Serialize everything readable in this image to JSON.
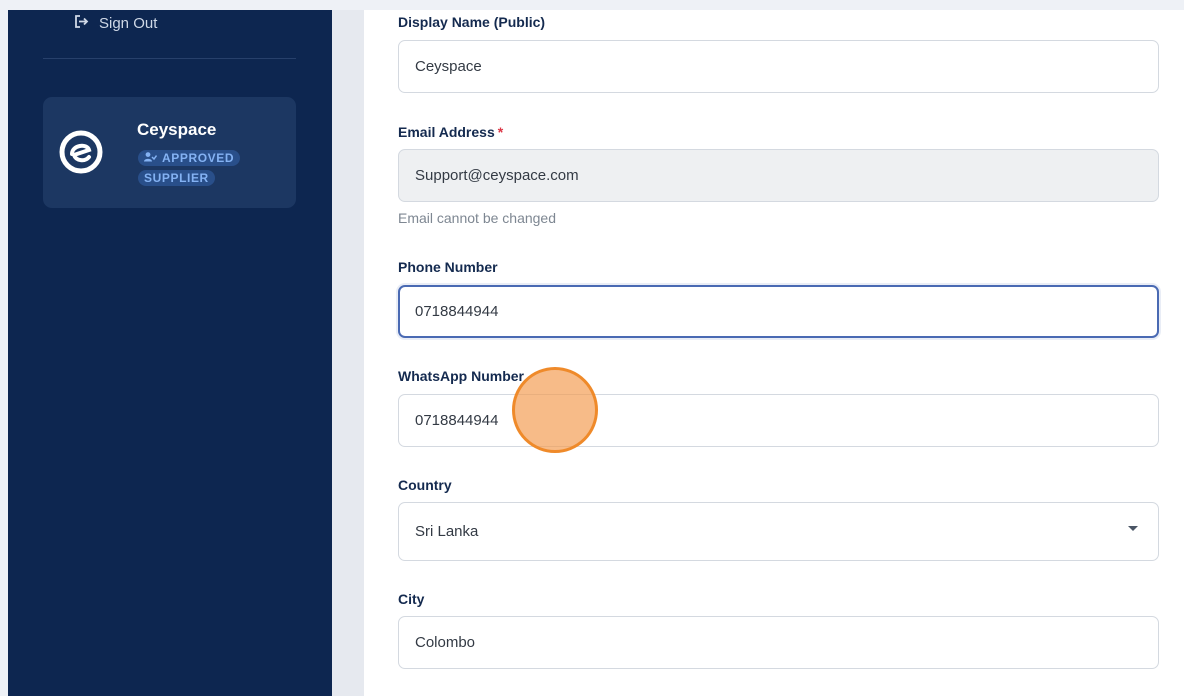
{
  "sidebar": {
    "sign_out_label": "Sign Out",
    "profile": {
      "name": "Ceyspace",
      "badge_line1": "APPROVED",
      "badge_line2": "SUPPLIER"
    }
  },
  "form": {
    "display_name": {
      "label": "Display Name (Public)",
      "value": "Ceyspace"
    },
    "email": {
      "label": "Email Address",
      "required_mark": "*",
      "value": "Support@ceyspace.com",
      "help": "Email cannot be changed"
    },
    "phone": {
      "label": "Phone Number",
      "value": "0718844944"
    },
    "whatsapp": {
      "label": "WhatsApp Number",
      "value": "0718844944"
    },
    "country": {
      "label": "Country",
      "value": "Sri Lanka"
    },
    "city": {
      "label": "City",
      "value": "Colombo"
    }
  },
  "colors": {
    "sidebar_bg": "#0d2650",
    "card_bg": "#1c3762",
    "badge_text": "#84b2f3",
    "required": "#dc3545",
    "focus_border": "#4a6ab3",
    "click_indicator": "#ef8a2a"
  },
  "icons": [
    "sign-out-icon",
    "brand-logo-icon",
    "user-check-icon",
    "chevron-down-icon"
  ]
}
